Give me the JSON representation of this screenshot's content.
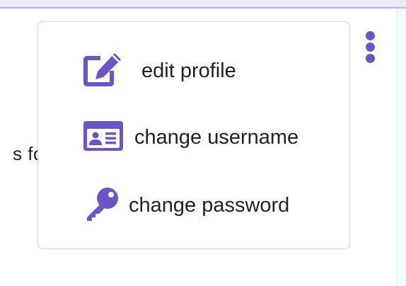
{
  "background": {
    "partial_text": "s  fol"
  },
  "menu": {
    "items": [
      {
        "label": "edit profile",
        "icon": "edit-icon"
      },
      {
        "label": "change username",
        "icon": "id-card-icon"
      },
      {
        "label": "change password",
        "icon": "key-icon"
      }
    ]
  },
  "colors": {
    "accent": "#6a56c6",
    "top_band": "#ebe8f7",
    "right_panel": "#f1fbfd"
  },
  "kebab": {
    "icon": "more-vertical-icon"
  }
}
